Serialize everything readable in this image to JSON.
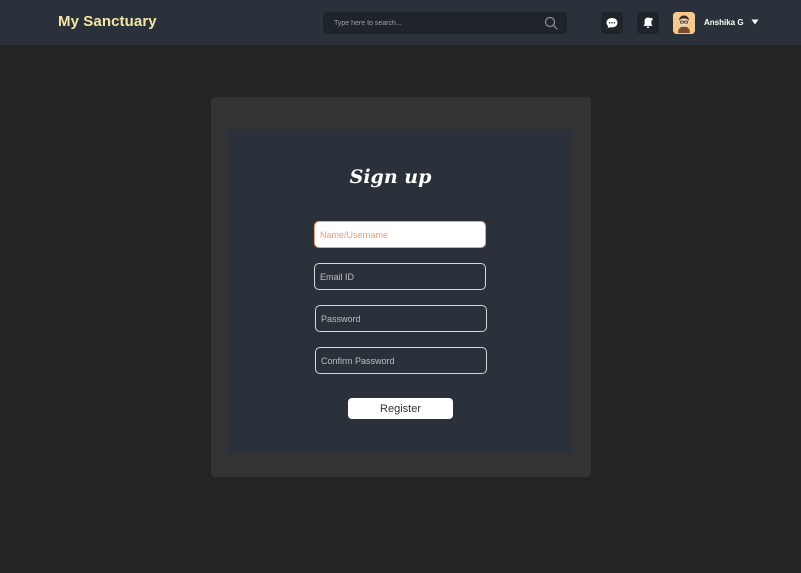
{
  "header": {
    "brand": "My Sanctuary",
    "search": {
      "placeholder": "Type here to search..."
    },
    "icons": [
      "chat-icon",
      "bell-icon"
    ],
    "user": {
      "name": "Anshika G",
      "avatar": "avatar-icon",
      "menu_icon": "caret-down-icon"
    }
  },
  "signup": {
    "title": "Sign up",
    "fields": {
      "name": {
        "placeholder": "Name/Username",
        "value": ""
      },
      "email": {
        "placeholder": "Email ID",
        "value": ""
      },
      "password": {
        "placeholder": "Password",
        "value": ""
      },
      "confirm": {
        "placeholder": "Confirm Password",
        "value": ""
      }
    },
    "submit_label": "Register"
  },
  "colors": {
    "navbar": "#2b313a",
    "background": "#242424",
    "brand": "#f3e6a6",
    "focus_border": "#f3a07c"
  }
}
